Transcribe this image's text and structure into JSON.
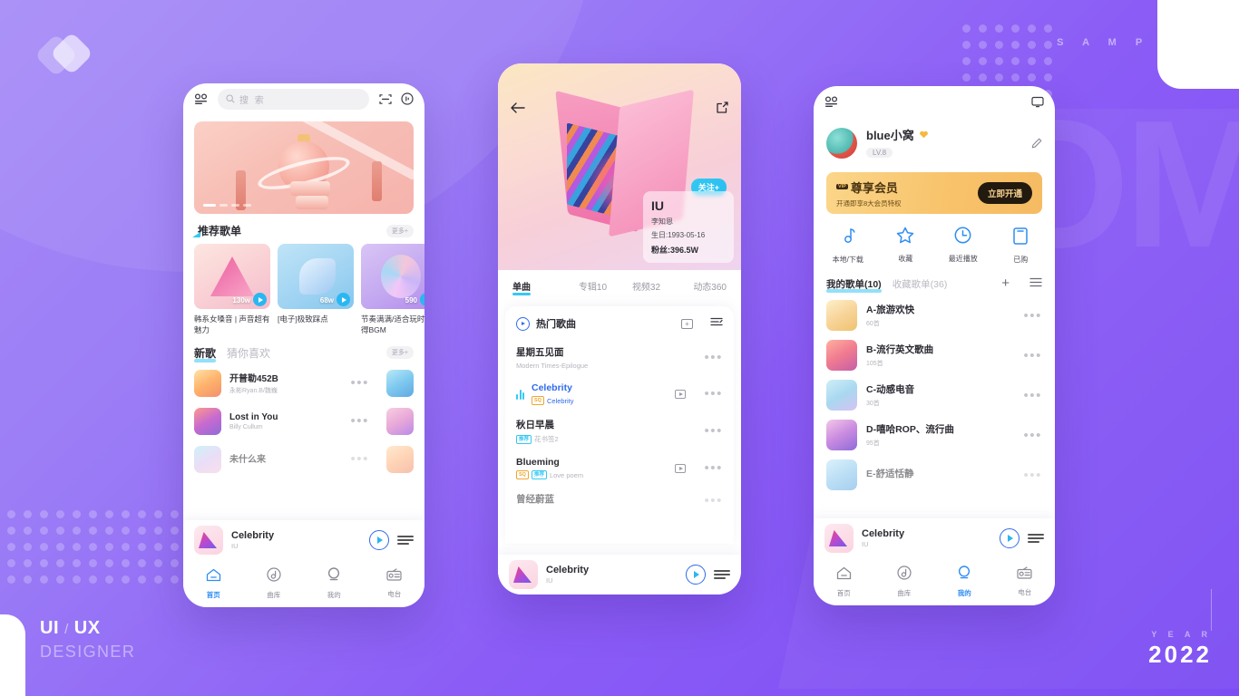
{
  "poster": {
    "sample_word": "S A M P L E",
    "brand_line1_a": "UI",
    "brand_line1_sep": "/",
    "brand_line1_b": "UX",
    "brand_line2": "DESIGNER",
    "year_label": "Y E A R",
    "year_value": "2022",
    "watermark": "MOM",
    "accent": "#8b5cf6"
  },
  "phone1": {
    "search_placeholder": "搜 索",
    "hero": {
      "dots": 4,
      "active_dot": 1
    },
    "recommend": {
      "title": "推荐歌单",
      "more": "更多+",
      "cards": [
        {
          "plays": "130w",
          "caption": "韩系女嗓音 | 声音超有魅力"
        },
        {
          "plays": "68w",
          "caption": "[电子]极致踩点"
        },
        {
          "plays": "590",
          "caption": "节奏满满/适合玩时听得BGM"
        }
      ]
    },
    "newsongs": {
      "tab_on": "新歌",
      "tab_off": "猜你喜欢",
      "more": "更多+",
      "items": [
        {
          "title": "开普勒452B",
          "artist": "永彬Ryan.B/魏巍"
        },
        {
          "title": "Lost in You",
          "artist": "Billy Cullum"
        },
        {
          "title": "未什么来",
          "artist": ""
        }
      ]
    },
    "mini_player": {
      "title": "Celebrity",
      "artist": "IU"
    },
    "tabbar": [
      {
        "label": "首页",
        "icon": "home-icon",
        "active": true
      },
      {
        "label": "曲库",
        "icon": "music-note-icon",
        "active": false
      },
      {
        "label": "我的",
        "icon": "person-icon",
        "active": false
      },
      {
        "label": "电台",
        "icon": "radio-icon",
        "active": false
      }
    ]
  },
  "phone2": {
    "back_icon": "back-arrow-icon",
    "share_icon": "share-icon",
    "follow_label": "关注+",
    "artist": {
      "name": "IU",
      "real_name": "李知恩",
      "birthday": "生日:1993-05-16",
      "fans": "粉丝:396.5W"
    },
    "tabs": [
      {
        "label": "单曲",
        "active": true
      },
      {
        "label": "专辑10",
        "active": false
      },
      {
        "label": "视频32",
        "active": false
      },
      {
        "label": "动态360",
        "active": false
      }
    ],
    "sheet_title": "热门歌曲",
    "songs": [
      {
        "title": "星期五见面",
        "sub": "Modern Times-Epilogue",
        "playing": false,
        "video": false,
        "badges": []
      },
      {
        "title": "Celebrity",
        "sub": "Celebrity",
        "playing": true,
        "video": true,
        "badges": [
          "SQ"
        ]
      },
      {
        "title": "秋日早晨",
        "sub": "花书签2",
        "playing": false,
        "video": false,
        "badges": [
          "推荐"
        ]
      },
      {
        "title": "Blueming",
        "sub": "Love poem",
        "playing": false,
        "video": true,
        "badges": [
          "SQ",
          "推荐"
        ]
      },
      {
        "title": "曾经蔚蓝",
        "sub": "",
        "playing": false,
        "video": false,
        "badges": []
      }
    ],
    "mini_player": {
      "title": "Celebrity",
      "artist": "IU"
    }
  },
  "phone3": {
    "message_icon": "message-icon",
    "edit_icon": "edit-pencil-icon",
    "user": {
      "name": "blue小窝",
      "level": "LV.8",
      "heart": "heart-icon"
    },
    "vip": {
      "tag": "VIP",
      "title": "尊享会员",
      "subtitle": "开通即享8大会员特权",
      "button": "立即开通"
    },
    "quick": [
      {
        "label": "本地/下载",
        "icon": "music-note-icon"
      },
      {
        "label": "收藏",
        "icon": "star-icon"
      },
      {
        "label": "最近播放",
        "icon": "clock-icon"
      },
      {
        "label": "已购",
        "icon": "bag-icon"
      }
    ],
    "list_tabs": {
      "on": "我的歌单(10)",
      "off": "收藏歌单(36)",
      "add_icon": "plus-icon",
      "sort_icon": "list-icon"
    },
    "playlists": [
      {
        "name": "A-旅游欢快",
        "count": "60首"
      },
      {
        "name": "B-流行英文歌曲",
        "count": "105首"
      },
      {
        "name": "C-动感电音",
        "count": "30首"
      },
      {
        "name": "D-嘻哈ROP、流行曲",
        "count": "95首"
      },
      {
        "name": "E-舒适恬静",
        "count": ""
      }
    ],
    "mini_player": {
      "title": "Celebrity",
      "artist": "IU"
    },
    "tabbar": [
      {
        "label": "首页",
        "icon": "home-icon",
        "active": false
      },
      {
        "label": "曲库",
        "icon": "music-note-icon",
        "active": false
      },
      {
        "label": "我的",
        "icon": "person-icon",
        "active": true
      },
      {
        "label": "电台",
        "icon": "radio-icon",
        "active": false
      }
    ]
  }
}
